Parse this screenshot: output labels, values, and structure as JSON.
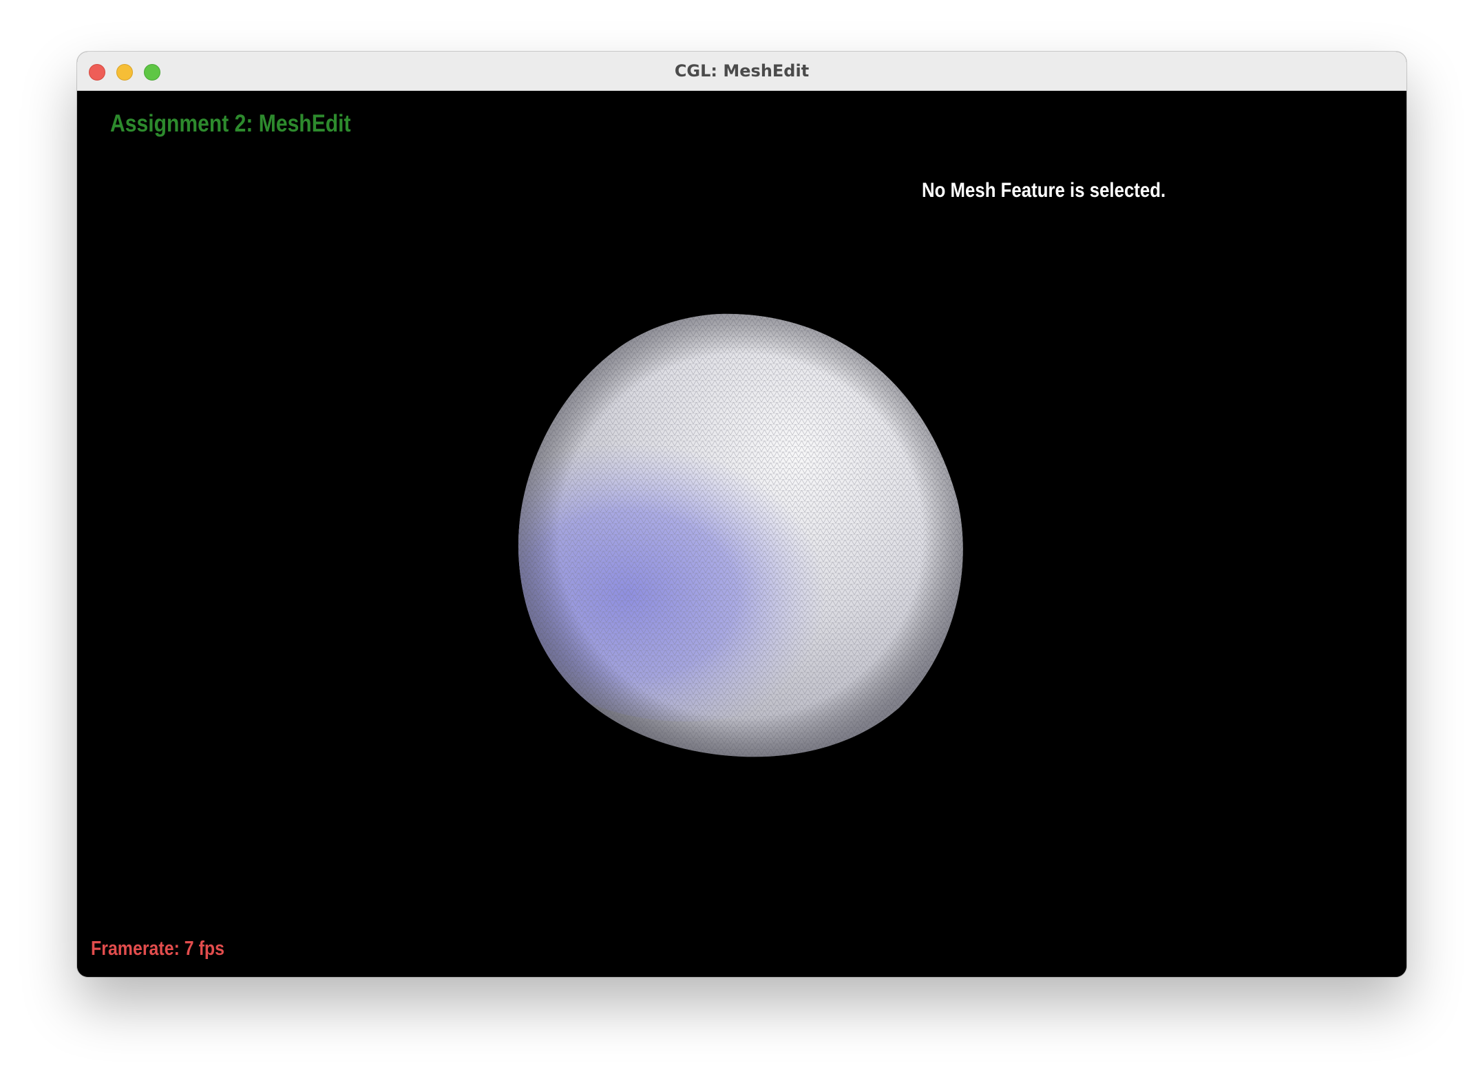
{
  "window": {
    "title": "CGL: MeshEdit"
  },
  "viewport": {
    "app_title": "Assignment 2: MeshEdit",
    "selection_status": "No Mesh Feature is selected.",
    "framerate_label": "Framerate:",
    "framerate_value": "7 fps"
  },
  "mesh": {
    "shape": "sphere",
    "render_mode": "wireframe-shaded",
    "base_color": "#f0f0f2",
    "tint_color": "#8c8ce0",
    "wire_color": "#7a7a86"
  },
  "colors": {
    "background": "#000000",
    "app_title": "#2d8a2d",
    "status_text": "#ffffff",
    "framerate": "#e24d4d"
  }
}
